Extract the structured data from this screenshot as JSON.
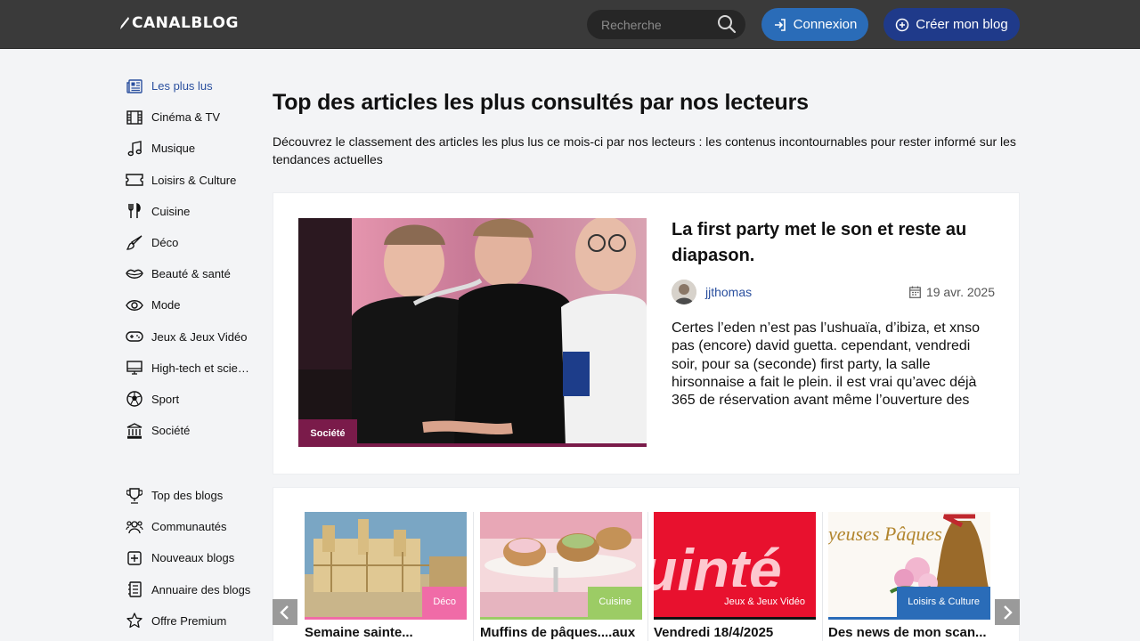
{
  "header": {
    "logo_text": "CANALBLOG",
    "search_placeholder": "Recherche",
    "login_label": "Connexion",
    "create_label": "Créer mon blog",
    "colors": {
      "bar": "#3a3a3a",
      "login": "#2a6cb8",
      "create": "#1f3a8a"
    }
  },
  "sidebar": {
    "categories": [
      {
        "label": "Les plus lus",
        "icon": "newspaper-icon",
        "active": true
      },
      {
        "label": "Cinéma & TV",
        "icon": "film-icon"
      },
      {
        "label": "Musique",
        "icon": "music-note-icon"
      },
      {
        "label": "Loisirs & Culture",
        "icon": "ticket-icon"
      },
      {
        "label": "Cuisine",
        "icon": "utensils-icon"
      },
      {
        "label": "Déco",
        "icon": "paintbrush-icon"
      },
      {
        "label": "Beauté & santé",
        "icon": "lips-icon"
      },
      {
        "label": "Mode",
        "icon": "eye-icon"
      },
      {
        "label": "Jeux & Jeux Vidéo",
        "icon": "gamepad-icon"
      },
      {
        "label": "High-tech et scien...",
        "icon": "monitor-icon"
      },
      {
        "label": "Sport",
        "icon": "soccer-ball-icon"
      },
      {
        "label": "Société",
        "icon": "institution-icon"
      }
    ],
    "secondary": [
      {
        "label": "Top des blogs",
        "icon": "trophy-icon"
      },
      {
        "label": "Communautés",
        "icon": "users-icon"
      },
      {
        "label": "Nouveaux blogs",
        "icon": "plus-square-icon"
      },
      {
        "label": "Annuaire des blogs",
        "icon": "directory-icon"
      },
      {
        "label": "Offre Premium",
        "icon": "star-icon"
      }
    ]
  },
  "main": {
    "title": "Top des articles les plus consultés par nos lecteurs",
    "description": "Découvrez le classement des articles les plus lus ce mois-ci par nos lecteurs : les contenus incontournables pour rester informé sur les tendances actuelles",
    "featured": {
      "category": "Société",
      "category_color": "#7a1b4a",
      "title": "La first party met le son et reste au diapason.",
      "author": "jjthomas",
      "date": "19 avr. 2025",
      "excerpt": "Certes l’eden n’est pas l’ushuaïa, d’ibiza, et xnso pas (encore) david guetta. cependant, vendredi soir, pour sa (seconde) first party, la salle hirsonnaise a fait le plein. il est vrai qu’avec déjà 365 de réservation avant même l’ouverture des"
    },
    "cards": [
      {
        "category": "Déco",
        "category_color": "#f06ba7",
        "title": "Semaine sainte..."
      },
      {
        "category": "Cuisine",
        "category_color": "#9ccc65",
        "title": "Muffins de pâques....aux"
      },
      {
        "category": "Jeux & Jeux Vidéo",
        "category_color": "#111111",
        "title": "Vendredi 18/4/2025"
      },
      {
        "category": "Loisirs & Culture",
        "category_color": "#2a6cb8",
        "title": "Des news de mon scan..."
      }
    ],
    "card3_image_text": "uinté",
    "card4_image_text": "yeuses Pâques"
  }
}
